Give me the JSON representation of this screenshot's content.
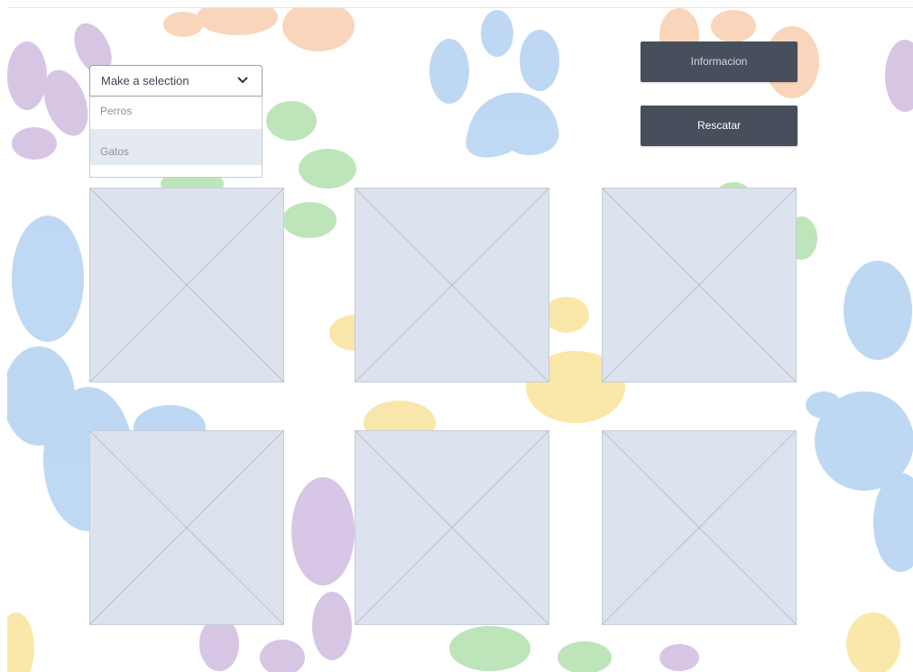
{
  "dropdown": {
    "selected_label": "Make a selection",
    "options": [
      {
        "label": "Perros"
      },
      {
        "label": "Gatos",
        "highlighted": true
      }
    ],
    "chevron_icon": "chevron-down-icon"
  },
  "buttons": {
    "info_label": "Informacion",
    "rescue_label": "Rescatar",
    "color": "#474f5c"
  },
  "gallery": {
    "placeholder_icon": "image-placeholder-icon",
    "placeholder_color": "#dde3ee",
    "count": 6
  },
  "background": {
    "pattern": "colorful-paw-prints",
    "colors": [
      "#c9b3dc",
      "#f7c7a6",
      "#a9ccf0",
      "#a9dca4",
      "#f8df8e"
    ]
  }
}
